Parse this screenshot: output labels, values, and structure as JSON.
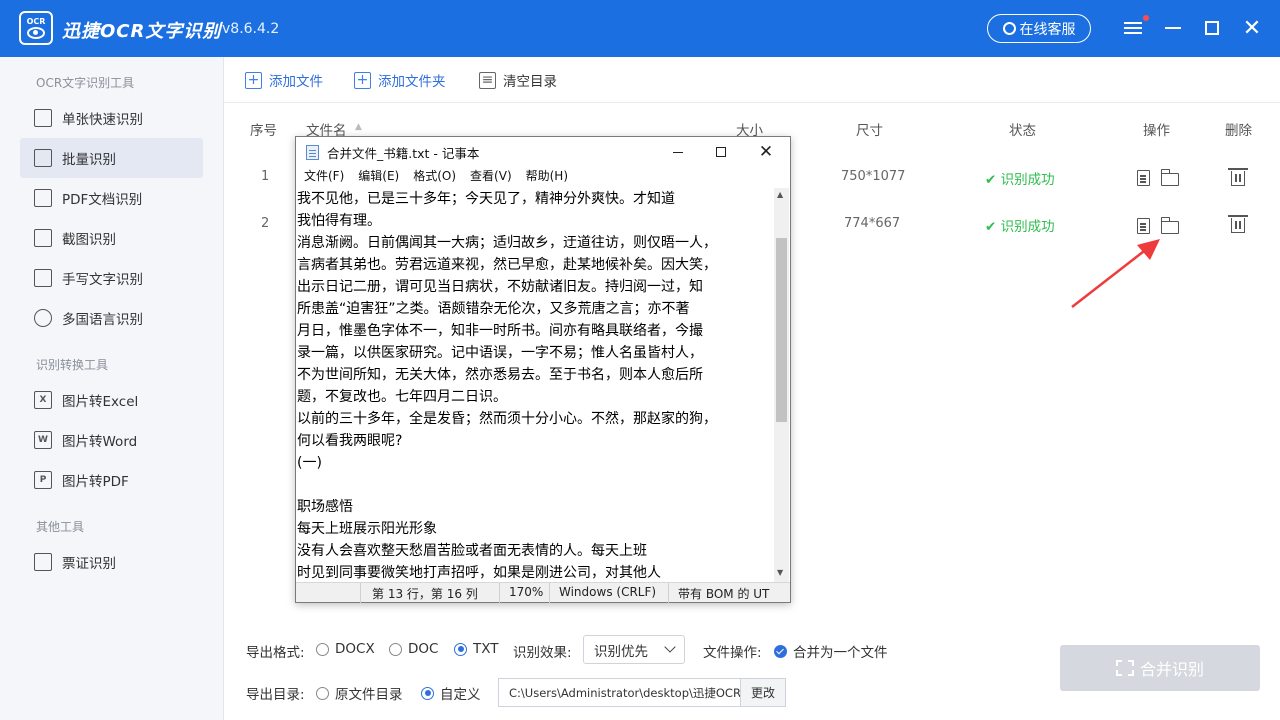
{
  "app": {
    "logo_text": "OCR",
    "title": "迅捷OCR文字识别",
    "version": "v8.6.4.2",
    "service_label": "在线客服"
  },
  "sidebar": {
    "sections": [
      {
        "label": "OCR文字识别工具"
      },
      {
        "label": "识别转换工具"
      },
      {
        "label": "其他工具"
      }
    ],
    "items": [
      {
        "label": "单张快速识别",
        "icon": "single-image-icon"
      },
      {
        "label": "批量识别",
        "icon": "batch-icon",
        "active": true
      },
      {
        "label": "PDF文档识别",
        "icon": "pdf-icon"
      },
      {
        "label": "截图识别",
        "icon": "crop-icon"
      },
      {
        "label": "手写文字识别",
        "icon": "pen-icon"
      },
      {
        "label": "多国语言识别",
        "icon": "globe-icon"
      },
      {
        "label": "图片转Excel",
        "icon": "excel-icon",
        "glyph": "X"
      },
      {
        "label": "图片转Word",
        "icon": "word-icon",
        "glyph": "W"
      },
      {
        "label": "图片转PDF",
        "icon": "pdf-file-icon",
        "glyph": "P"
      },
      {
        "label": "票证识别",
        "icon": "ticket-icon"
      }
    ]
  },
  "toolbar": {
    "add_file": "添加文件",
    "add_folder": "添加文件夹",
    "clear": "清空目录"
  },
  "table": {
    "headers": {
      "index": "序号",
      "filename": "文件名",
      "size": "大小",
      "dimensions": "尺寸",
      "status": "状态",
      "actions": "操作",
      "delete": "删除"
    },
    "rows": [
      {
        "index": "1",
        "dimensions": "750*1077",
        "status": "识别成功"
      },
      {
        "index": "2",
        "dimensions": "774*667",
        "status": "识别成功"
      }
    ]
  },
  "notepad": {
    "title": "合并文件_书籍.txt - 记事本",
    "menu": [
      "文件(F)",
      "编辑(E)",
      "格式(O)",
      "查看(V)",
      "帮助(H)"
    ],
    "lines": [
      "我不见他，已是三十多年；今天见了，精神分外爽快。才知道",
      "我怕得有理。",
      "消息渐阙。日前偶闻其一大病；适归故乡，迂道往访，则仅晤一人，",
      "言病者其弟也。劳君远道来视，然已早愈，赴某地候补矣。因大笑，",
      "出示日记二册，谓可见当日病状，不妨献诸旧友。持归阅一过，知",
      "所患盖“迫害狂”之类。语颇错杂无伦次，又多荒唐之言；亦不著",
      "月日，惟墨色字体不一，知非一时所书。间亦有略具联络者，今撮",
      "录一篇，以供医家研究。记中语误，一字不易；惟人名虽皆村人，",
      "不为世间所知，无关大体，然亦悉易去。至于书名，则本人愈后所",
      "题，不复改也。七年四月二日识。",
      "以前的三十多年，全是发昏；然而须十分小心。不然，那赵家的狗，",
      "何以看我两眼呢?",
      "(一)",
      "",
      "职场感悟",
      "每天上班展示阳光形象",
      "没有人会喜欢整天愁眉苦脸或者面无表情的人。每天上班",
      "时见到同事要微笑地打声招呼，如果是刚进公司，对其他人"
    ],
    "status": {
      "position": "第 13 行，第 16 列",
      "zoom": "170%",
      "line_ending": "Windows (CRLF)",
      "encoding": "带有 BOM 的 UT"
    }
  },
  "bottom": {
    "export_format_label": "导出格式:",
    "formats": [
      "DOCX",
      "DOC",
      "TXT"
    ],
    "selected_format": "TXT",
    "effect_label": "识别效果:",
    "effect_value": "识别优先",
    "file_op_label": "文件操作:",
    "merge_option": "合并为一个文件",
    "export_dir_label": "导出目录:",
    "dir_options": [
      "原文件目录",
      "自定义"
    ],
    "selected_dir": "自定义",
    "path_value": "C:\\Users\\Administrator\\desktop\\迅捷OCR文",
    "change_label": "更改",
    "merge_button": "合并识别"
  },
  "colors": {
    "brand": "#1b6fe0",
    "success": "#2ebd4e",
    "annotation_arrow": "#ee3b3b"
  }
}
